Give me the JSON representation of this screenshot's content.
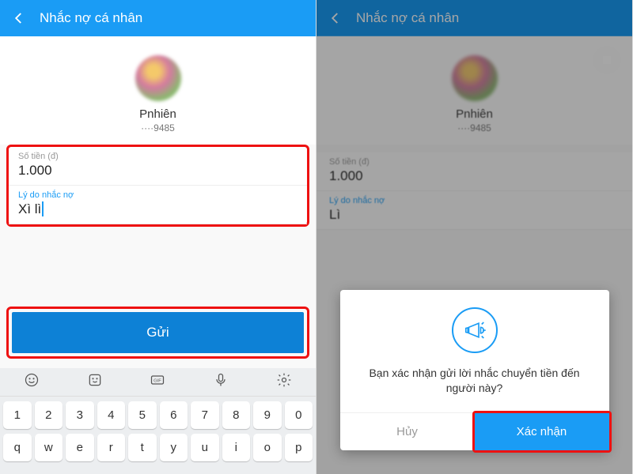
{
  "header": {
    "title": "Nhắc nợ cá nhân"
  },
  "contact": {
    "name": "Pnhiên",
    "account": "····9485"
  },
  "left": {
    "amount_label": "Số tiền (đ)",
    "amount_value": "1.000",
    "reason_label": "Lý do nhắc nợ",
    "reason_value": "Xì lì",
    "send_button": "Gửi"
  },
  "right": {
    "amount_label": "Số tiền (đ)",
    "amount_value": "1.000",
    "reason_label": "Lý do nhắc nợ",
    "reason_value": "Lì"
  },
  "dialog": {
    "message": "Bạn xác nhận gửi lời nhắc chuyển tiền đến người này?",
    "cancel": "Hủy",
    "confirm": "Xác nhận"
  },
  "keyboard": {
    "row1": [
      "1",
      "2",
      "3",
      "4",
      "5",
      "6",
      "7",
      "8",
      "9",
      "0"
    ],
    "row2": [
      "q",
      "w",
      "e",
      "r",
      "t",
      "y",
      "u",
      "i",
      "o",
      "p"
    ]
  }
}
